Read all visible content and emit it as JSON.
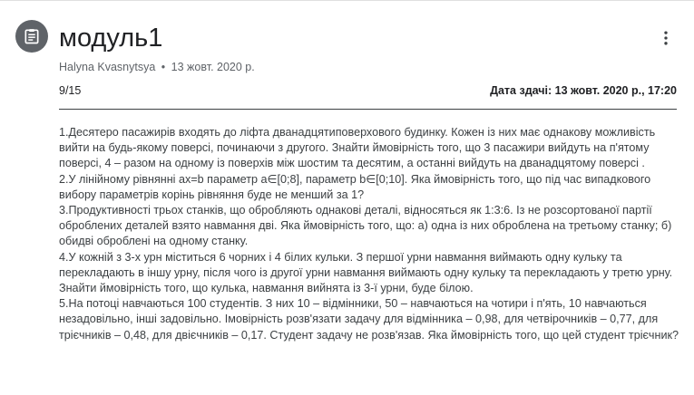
{
  "header": {
    "icon": "assignment-icon",
    "title": "модуль1",
    "more_icon": "more-vert-icon"
  },
  "meta": {
    "author": "Halyna Kvasnytsya",
    "separator": "•",
    "date": "13 жовт. 2020 р."
  },
  "points": "9/15",
  "due": "Дата здачі: 13 жовт. 2020 р., 17:20",
  "description": [
    "1.Десятеро пасажирів входять до ліфта дванадцятиповерхового будинку. Кожен із них має однакову можливість вийти на будь-якому поверсі, починаючи з другого. Знайти ймовірність того, що 3 пасажири вийдуть на п'ятому поверсі, 4 – разом на одному із поверхів між шостим та десятим, а останні вийдуть на дванадцятому поверсі .",
    "2.У лінійному рівнянні ax=b параметр a∈[0;8], параметр b∈[0;10]. Яка ймовірність того, що під час випадкового вибору параметрів корінь рівняння буде не менший за 1?",
    "3.Продуктивності трьох станків, що обробляють однакові деталі, відносяться як 1:3:6. Із не розсортованої партії оброблених деталей взято навмання дві. Яка ймовірність того, що: а) одна із них оброблена на третьому станку; б) обидві оброблені на одному станку.",
    "4.У кожній з 3-х урн міститься 6 чорних і 4 білих кульки. З першої урни навмання виймають одну кульку та перекладають в іншу урну, після чого із другої урни навмання виймають одну кульку та перекладають у третю урну. Знайти ймовірність того, що кулька, навмання вийнята із 3-ї урни, буде білою.",
    "5.На потоці навчаються 100 студентів. З них 10 – відмінники, 50 – навчаються на чотири і п'ять, 10 навчаються незадовільно, інші задовільно. Імовірність розв'язати задачу для відмінника – 0,98, для четвірочників – 0,77, для трієчників – 0,48, для двієчників – 0,17. Студент задачу не розв'язав. Яка ймовірність того, що цей студент трієчник?"
  ]
}
